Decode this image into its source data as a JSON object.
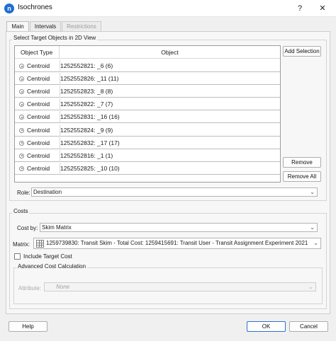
{
  "window": {
    "title": "Isochrones",
    "icon_letter": "n",
    "help_glyph": "?",
    "close_glyph": "✕"
  },
  "tabs": [
    {
      "label": "Main"
    },
    {
      "label": "Intervals"
    },
    {
      "label": "Restrictions"
    }
  ],
  "target_group": {
    "label": "Select Target Objects in 2D View",
    "columns": [
      "Object Type",
      "Object"
    ],
    "rows": [
      {
        "type": "Centroid",
        "object": "1252552821: _6 (6)"
      },
      {
        "type": "Centroid",
        "object": "1252552826: _11 (11)"
      },
      {
        "type": "Centroid",
        "object": "1252552823: _8 (8)"
      },
      {
        "type": "Centroid",
        "object": "1252552822: _7 (7)"
      },
      {
        "type": "Centroid",
        "object": "1252552831: _16 (16)"
      },
      {
        "type": "Centroid",
        "object": "1252552824: _9 (9)"
      },
      {
        "type": "Centroid",
        "object": "1252552832: _17 (17)"
      },
      {
        "type": "Centroid",
        "object": "1252552816: _1 (1)"
      },
      {
        "type": "Centroid",
        "object": "1252552825: _10 (10)"
      }
    ],
    "add_selection_label": "Add Selection",
    "remove_label": "Remove",
    "remove_all_label": "Remove All",
    "role_label": "Role:",
    "role_value": "Destination"
  },
  "costs_group": {
    "label": "Costs",
    "cost_by_label": "Cost by:",
    "cost_by_value": "Skim Matrix",
    "matrix_label": "Matrix:",
    "matrix_value": "1259739830: Transit Skim - Total Cost: 1259415691: Transit User - Transit Assignment Experiment 2021",
    "include_target_cost_label": "Include Target Cost",
    "include_target_cost_checked": false,
    "advanced_label": "Advanced Cost Calculation",
    "attribute_label": "Attribute:",
    "attribute_value": "None"
  },
  "footer": {
    "help_label": "Help",
    "ok_label": "OK",
    "cancel_label": "Cancel"
  }
}
